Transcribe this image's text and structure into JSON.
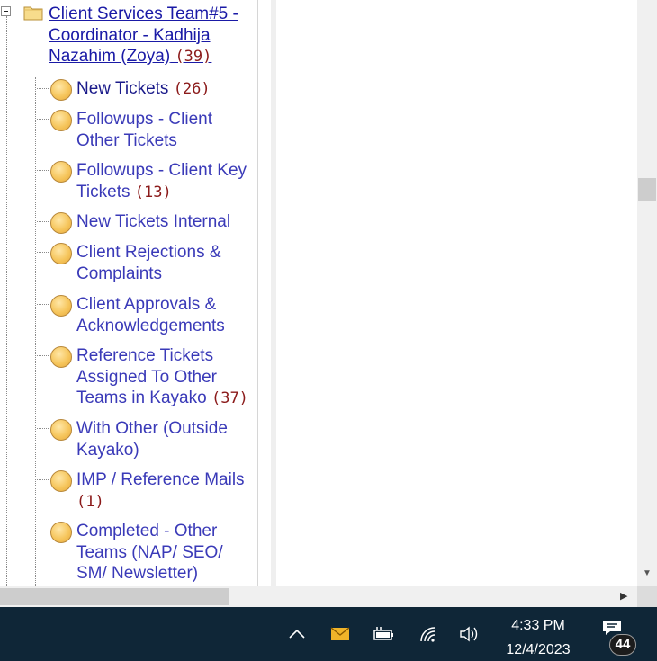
{
  "tree": {
    "root": {
      "label": "Client Services Team#5 - Coordinator - Kadhija Nazahim (Zoya)",
      "count": "(39)"
    },
    "items": [
      {
        "label": "New Tickets",
        "count": "(26)"
      },
      {
        "label": "Followups - Client Other Tickets",
        "count": ""
      },
      {
        "label": "Followups - Client Key Tickets",
        "count": "(13)"
      },
      {
        "label": "New Tickets Internal",
        "count": ""
      },
      {
        "label": "Client Rejections & Complaints",
        "count": ""
      },
      {
        "label": "Client Approvals & Acknowledgements",
        "count": ""
      },
      {
        "label": "Reference Tickets Assigned To Other Teams in Kayako",
        "count": "(37)"
      },
      {
        "label": "With Other (Outside Kayako)",
        "count": ""
      },
      {
        "label": "IMP / Reference Mails",
        "count": "(1)"
      },
      {
        "label": "Completed - Other Teams (NAP/ SEO/ SM/ Newsletter)",
        "count": ""
      }
    ]
  },
  "taskbar": {
    "time": "4:33 PM",
    "date": "12/4/2023",
    "notification_count": "44",
    "tray_icons": [
      "chevron-up-icon",
      "mail-icon",
      "battery-icon",
      "wifi-icon",
      "volume-icon",
      "notification-icon"
    ],
    "accent": "#0f2637"
  }
}
